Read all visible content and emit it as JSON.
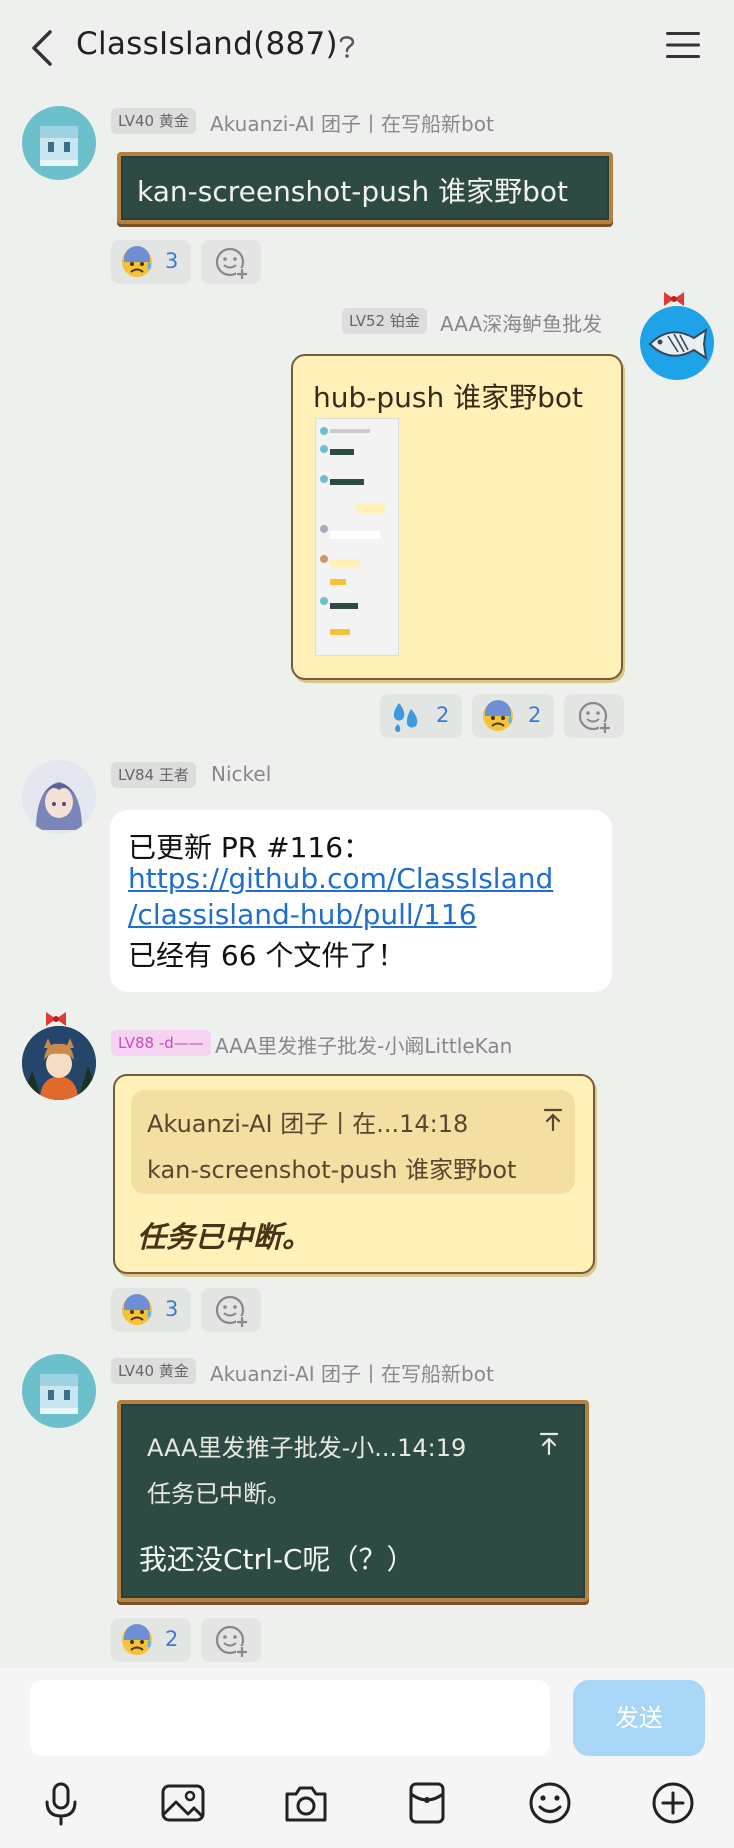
{
  "header": {
    "title": "ClassIsland(887)"
  },
  "messages": [
    {
      "badge": "LV40 黄金",
      "sender": "Akuanzi-AI 团子丨在写船新bot",
      "text": "kan-screenshot-push 谁家野bot",
      "reactions": [
        {
          "emoji": "anxious-sweat-face",
          "count": "3"
        }
      ]
    },
    {
      "badge": "LV52 铂金",
      "sender": "AAA深海鲈鱼批发",
      "text": "hub-push 谁家野bot",
      "reactions": [
        {
          "emoji": "sweat-droplets",
          "count": "2"
        },
        {
          "emoji": "anxious-sweat-face",
          "count": "2"
        }
      ]
    },
    {
      "badge": "LV84 王者",
      "sender": "Nickel",
      "line1": "已更新 PR #116：",
      "link1": "https://github.com/ClassIsland",
      "link2": "/classisland-hub/pull/116",
      "line3": "已经有 66 个文件了！"
    },
    {
      "badge": "LV88 -d——",
      "sender": "AAA里发推子批发-小阚LittleKan",
      "quote_header": "Akuanzi-AI 团子丨在...14:18",
      "quote_text": "kan-screenshot-push 谁家野bot",
      "text": "任务已中断。",
      "reactions": [
        {
          "emoji": "anxious-sweat-face",
          "count": "3"
        }
      ]
    },
    {
      "badge": "LV40 黄金",
      "sender": "Akuanzi-AI 团子丨在写船新bot",
      "quote_header": "AAA里发推子批发-小...14:19",
      "quote_text": "任务已中断。",
      "text": "我还没Ctrl-C呢（？）",
      "reactions": [
        {
          "emoji": "anxious-sweat-face",
          "count": "2"
        }
      ]
    }
  ],
  "composer": {
    "send_label": "发送"
  },
  "toolbar": [
    "microphone-icon",
    "image-icon",
    "camera-icon",
    "red-packet-icon",
    "emoji-icon",
    "plus-icon"
  ],
  "colors": {
    "background": "#eef0ee",
    "chalkboard": "#2e4a45",
    "chalk_frame": "#b6803e",
    "cat_bubble": "#fff1b8",
    "send_button": "#a8d6f6",
    "count_blue": "#3a7bd5"
  }
}
